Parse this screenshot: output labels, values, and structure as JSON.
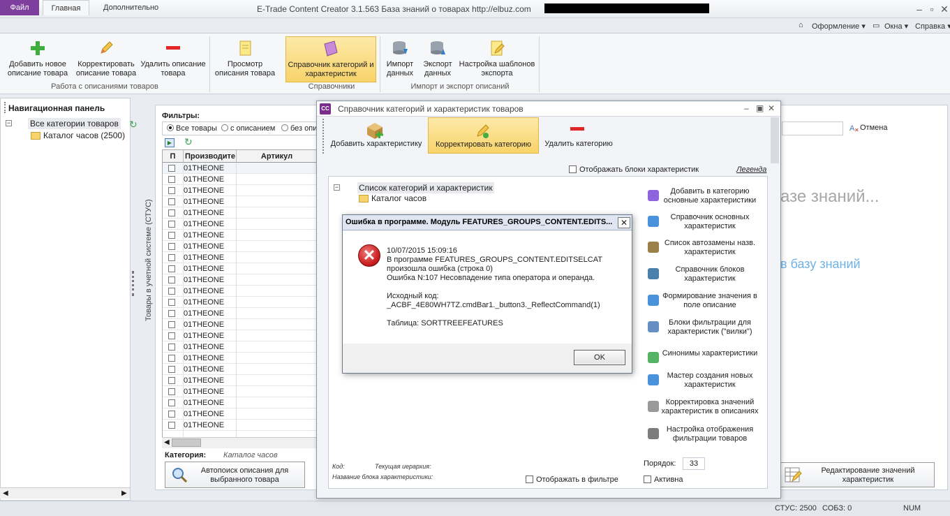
{
  "app": {
    "logo": "CC",
    "title": "E-Trade Content Creator 3.1.563     База знаний о товарах     http://elbuz.com"
  },
  "ribbon_tabs": {
    "file": "Файл",
    "home": "Главная",
    "extra": "Дополнительно",
    "design": "Оформление",
    "window": "Окна",
    "help": "Справка"
  },
  "ribbon": {
    "add_desc": "Добавить новое описание товара",
    "edit_desc": "Корректировать описание товара",
    "delete_desc": "Удалить описание товара",
    "group1": "Работа с описаниями товаров",
    "preview_desc": "Просмотр описания товара",
    "cat_ref": "Справочник категорий и характеристик",
    "group2": "Справочники",
    "import": "Импорт данных",
    "export": "Экспорт данных",
    "export_templates": "Настройка шаблонов экспорта",
    "group3": "Импорт и экспорт описаний"
  },
  "nav": {
    "title": "Навигационная панель",
    "all_categories": "Все категории товаров",
    "catalog": "Каталог часов (2500)"
  },
  "side_tab": "Товары в учетной системе (СТУС)",
  "products": {
    "filters_label": "Фильтры:",
    "filter_all": "Все товары",
    "filter_with": "с описанием",
    "filter_without": "без опи",
    "col_p": "П",
    "col_manufacturer": "Производите",
    "col_article": "Артикул",
    "rows": [
      "01THEONE",
      "01THEONE",
      "01THEONE",
      "01THEONE",
      "01THEONE",
      "01THEONE",
      "01THEONE",
      "01THEONE",
      "01THEONE",
      "01THEONE",
      "01THEONE",
      "01THEONE",
      "01THEONE",
      "01THEONE",
      "01THEONE",
      "01THEONE",
      "01THEONE",
      "01THEONE",
      "01THEONE",
      "01THEONE",
      "01THEONE",
      "01THEONE",
      "01THEONE",
      "01THEONE"
    ],
    "category_label": "Категория:",
    "category_value": "Каталог часов",
    "autosearch": "Автопоиск описания для выбранного товара"
  },
  "background": {
    "cancel": "Отмена",
    "heading": "азе знаний...",
    "link": "в базу знаний",
    "edit_values": "Редактирование значений характеристик"
  },
  "catdlg": {
    "logo": "CC",
    "title": "Справочник категорий и характеристик товаров",
    "add_feature": "Добавить характеристику",
    "edit_category": "Корректировать категорию",
    "delete_category": "Удалить категорию",
    "show_blocks": "Отображать блоки характеристик",
    "legend": "Легенда",
    "tree_root": "Список категорий и характеристик",
    "tree_child": "Каталог часов",
    "side_actions": [
      "Добавить в категорию основные характеристики",
      "Справочник основных характеристик",
      "Список автозамены назв. характеристик",
      "Справочник блоков характеристик",
      "Формирование значения в поле описание",
      "Блоки фильтрации для характеристик (\"вилки\")",
      "Синонимы характеристики",
      "Мастер создания новых характеристик",
      "Корректировка значений характеристик в описаниях",
      "Настройка отображения фильтрации товаров"
    ],
    "order_label": "Порядок:",
    "order_value": "33",
    "active": "Активна",
    "show_in_filter": "Отображать в фильтре",
    "kod": "Код:",
    "hierarchy": "Текущая иерархия:",
    "block_name": "Название блока характеристики:"
  },
  "error": {
    "title": "Ошибка в программе. Модуль FEATURES_GROUPS_CONTENT.EDITS...",
    "close": "✕",
    "lines": [
      "10/07/2015 15:09:16",
      "В программе FEATURES_GROUPS_CONTENT.EDITSELCAT",
      "произошла ошибка (строка 0)",
      "Ошибка N:107 Несовпадение типа оператора и операнда.",
      "Исходный код:",
      "_ACBF_4E80WH7TZ.cmdBar1._button3._ReflectCommand(1)",
      "Таблица: SORTTREEFEATURES"
    ],
    "ok": "OK"
  },
  "status": {
    "stus": "СТУС: 2500",
    "sobz": "СОБЗ: 0",
    "num": "NUM"
  },
  "colors": {
    "accent": "#7d3e9e",
    "active_button": "#f8d36a",
    "error_red": "#c81e1e",
    "link_blue": "#6fb2e6"
  }
}
